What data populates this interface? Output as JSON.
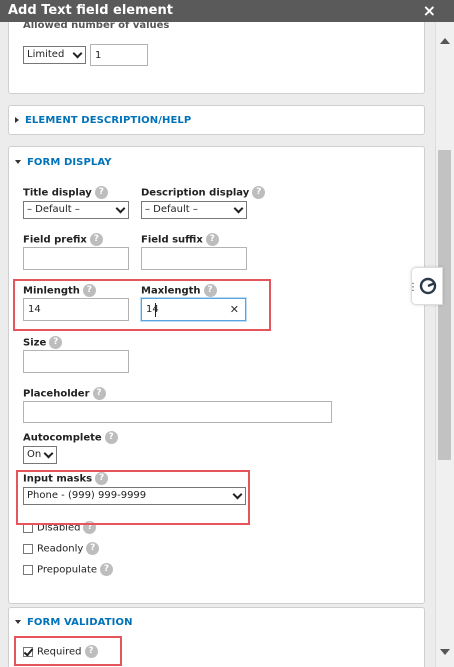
{
  "dialog": {
    "title": "Add Text field element",
    "close_glyph": "×"
  },
  "top_panel": {
    "header_partial": "Allowed number of values",
    "limit_select": "Limited",
    "limit_value": "1"
  },
  "element_description": {
    "header": "ELEMENT DESCRIPTION/HELP"
  },
  "form_display": {
    "header": "FORM DISPLAY",
    "title_display_label": "Title display",
    "title_display_value": "– Default –",
    "description_display_label": "Description display",
    "description_display_value": "– Default –",
    "field_prefix_label": "Field prefix",
    "field_suffix_label": "Field suffix",
    "minlength_label": "Minlength",
    "minlength_value": "14",
    "maxlength_label": "Maxlength",
    "maxlength_value": "14",
    "size_label": "Size",
    "placeholder_label": "Placeholder",
    "autocomplete_label": "Autocomplete",
    "autocomplete_value": "On",
    "input_masks_label": "Input masks",
    "input_masks_value": "Phone - (999) 999-9999",
    "disabled_label": "Disabled",
    "readonly_label": "Readonly",
    "prepopulate_label": "Prepopulate"
  },
  "form_validation": {
    "header": "FORM VALIDATION",
    "required_label": "Required",
    "required_checked": true
  },
  "help_glyph": "?",
  "colors": {
    "titlebar": "#5a5a5a",
    "link_header": "#0072b9",
    "highlight": "#e5555b",
    "focus": "#5aa5e0"
  },
  "icons": {
    "close": "close-icon",
    "help": "help-icon",
    "side_widget": "logo-icon"
  }
}
